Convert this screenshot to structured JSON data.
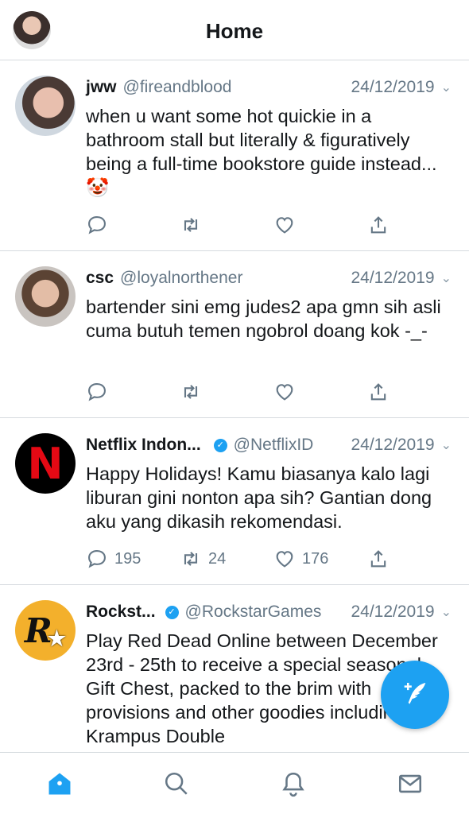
{
  "header": {
    "title": "Home",
    "avatar_icon": "profile-avatar"
  },
  "tweets": [
    {
      "name": "jww",
      "handle": "@fireandblood",
      "date": "24/12/2019",
      "text": "when u want some hot quickie in a bathroom stall but literally & figuratively being a full-time bookstore guide instead... 🤡",
      "verified": false,
      "replies": "",
      "retweets": "",
      "likes": ""
    },
    {
      "name": "csc",
      "handle": "@loyalnorthener",
      "date": "24/12/2019",
      "text": "bartender sini emg judes2 apa gmn sih asli cuma butuh temen ngobrol doang kok -_-",
      "verified": false,
      "replies": "",
      "retweets": "",
      "likes": ""
    },
    {
      "name": "Netflix Indon...",
      "handle": "@NetflixID",
      "date": "24/12/2019",
      "text": "Happy Holidays! Kamu biasanya kalo lagi liburan gini nonton apa sih? Gantian dong aku yang dikasih rekomendasi.",
      "verified": true,
      "replies": "195",
      "retweets": "24",
      "likes": "176",
      "avatar_letter": "N"
    },
    {
      "name": "Rockst...",
      "handle": "@RockstarGames",
      "date": "24/12/2019",
      "text": "Play Red Dead Online between December 23rd - 25th to receive a special seasonal Gift Chest, packed to the brim with provisions and other goodies including the Krampus Double",
      "verified": true,
      "avatar_letter": "R",
      "avatar_star": "★"
    }
  ],
  "tabbar": {
    "items": [
      "home-icon",
      "search-icon",
      "notifications-icon",
      "messages-icon"
    ],
    "active": "home-icon"
  },
  "colors": {
    "accent": "#1da1f2",
    "text": "#14171a",
    "secondary": "#657786",
    "divider": "#d6dbdf"
  }
}
